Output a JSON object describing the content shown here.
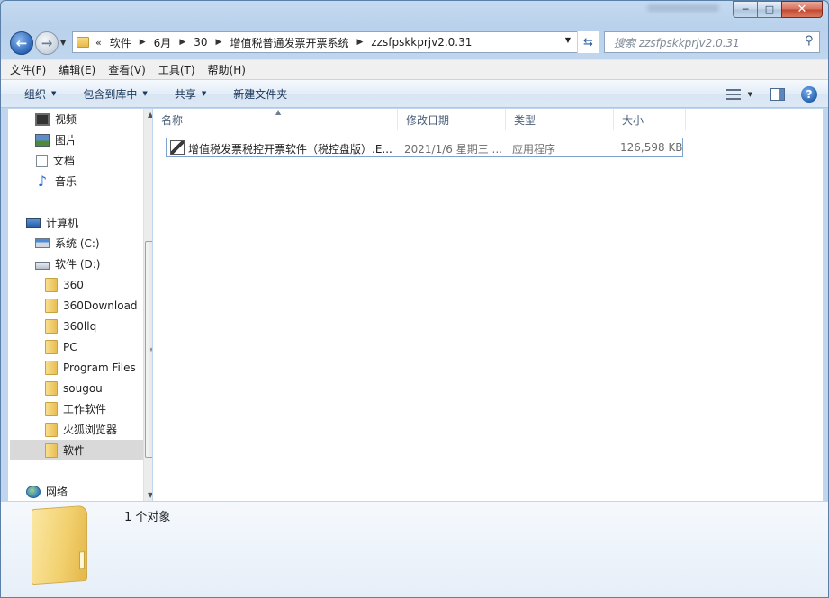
{
  "window": {
    "minimize_glyph": "─",
    "maximize_glyph": "□",
    "close_glyph": "✕"
  },
  "nav": {
    "back_glyph": "←",
    "forward_glyph": "→",
    "address_overflow": "«",
    "breadcrumbs": [
      "软件",
      "6月",
      "30",
      "增值税普通发票开票系统",
      "zzsfpskkprjv2.0.31"
    ],
    "breadcrumb_sep": "▶",
    "search_placeholder": "搜索 zzsfpskkprjv2.0.31"
  },
  "menubar": {
    "items": [
      "文件(F)",
      "编辑(E)",
      "查看(V)",
      "工具(T)",
      "帮助(H)"
    ]
  },
  "commandbar": {
    "organize": "组织",
    "include_in_library": "包含到库中",
    "share": "共享",
    "new_folder": "新建文件夹",
    "help_glyph": "?"
  },
  "navpane": {
    "libraries": [
      "视频",
      "图片",
      "文档",
      "音乐"
    ],
    "computer": "计算机",
    "drives": [
      "系统 (C:)",
      "软件 (D:)"
    ],
    "folders": [
      "360",
      "360Download",
      "360llq",
      "PC",
      "Program Files",
      "sougou",
      "工作软件",
      "火狐浏览器",
      "软件"
    ],
    "selected": "软件",
    "network": "网络"
  },
  "filelist": {
    "columns": {
      "name": "名称",
      "modified": "修改日期",
      "type": "类型",
      "size": "大小"
    },
    "rows": [
      {
        "name": "增值税发票税控开票软件（税控盘版）.E...",
        "modified": "2021/1/6 星期三 ...",
        "type": "应用程序",
        "size": "126,598 KB"
      }
    ]
  },
  "details": {
    "count_text": "1 个对象"
  }
}
